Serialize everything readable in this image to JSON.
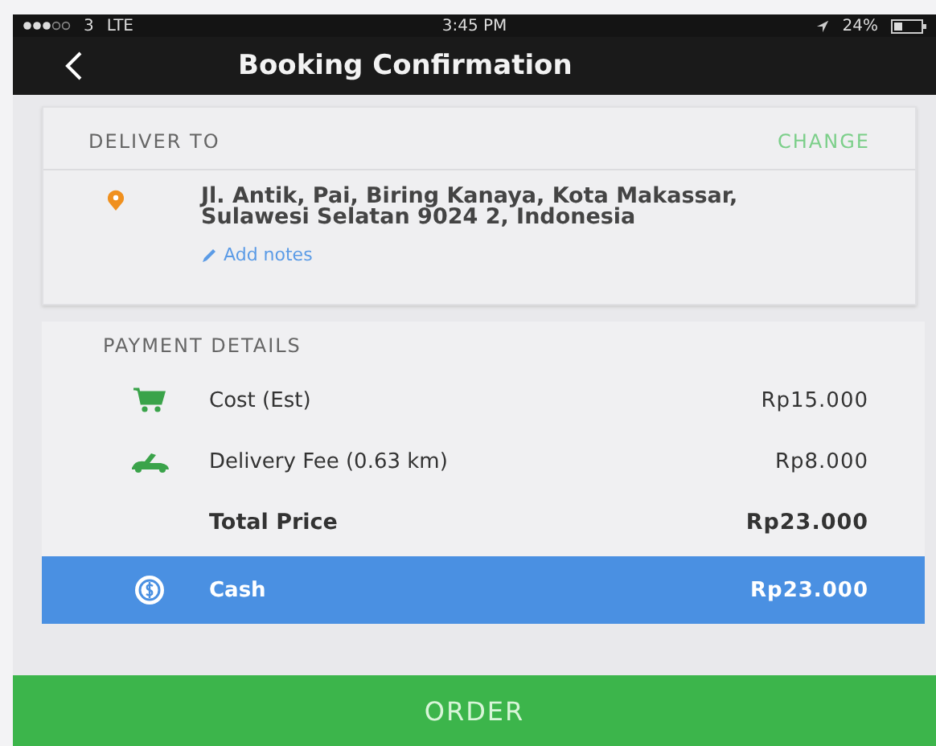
{
  "status_bar": {
    "carrier": "3",
    "network": "LTE",
    "time": "3:45 PM",
    "battery": "24%"
  },
  "nav": {
    "title": "Booking Confirmation"
  },
  "delivery": {
    "heading": "DELIVER TO",
    "action": "CHANGE",
    "address": "Jl. Antik, Pai, Biring Kanaya, Kota Makassar, Sulawesi Selatan 9024 2, Indonesia",
    "notes_link": "Add notes"
  },
  "payment": {
    "heading": "PAYMENT DETAILS",
    "rows": [
      {
        "kind": "cost",
        "label": "Cost (Est)",
        "amount": "Rp15.000"
      },
      {
        "kind": "delivery",
        "label": "Delivery Fee (0.63 km)",
        "amount": "Rp8.000"
      },
      {
        "kind": "total",
        "label": "Total Price",
        "amount": "Rp23.000"
      }
    ],
    "method": {
      "label": "Cash",
      "amount": "Rp23.000",
      "selected": true
    }
  },
  "order_button": {
    "label": "ORDER"
  }
}
